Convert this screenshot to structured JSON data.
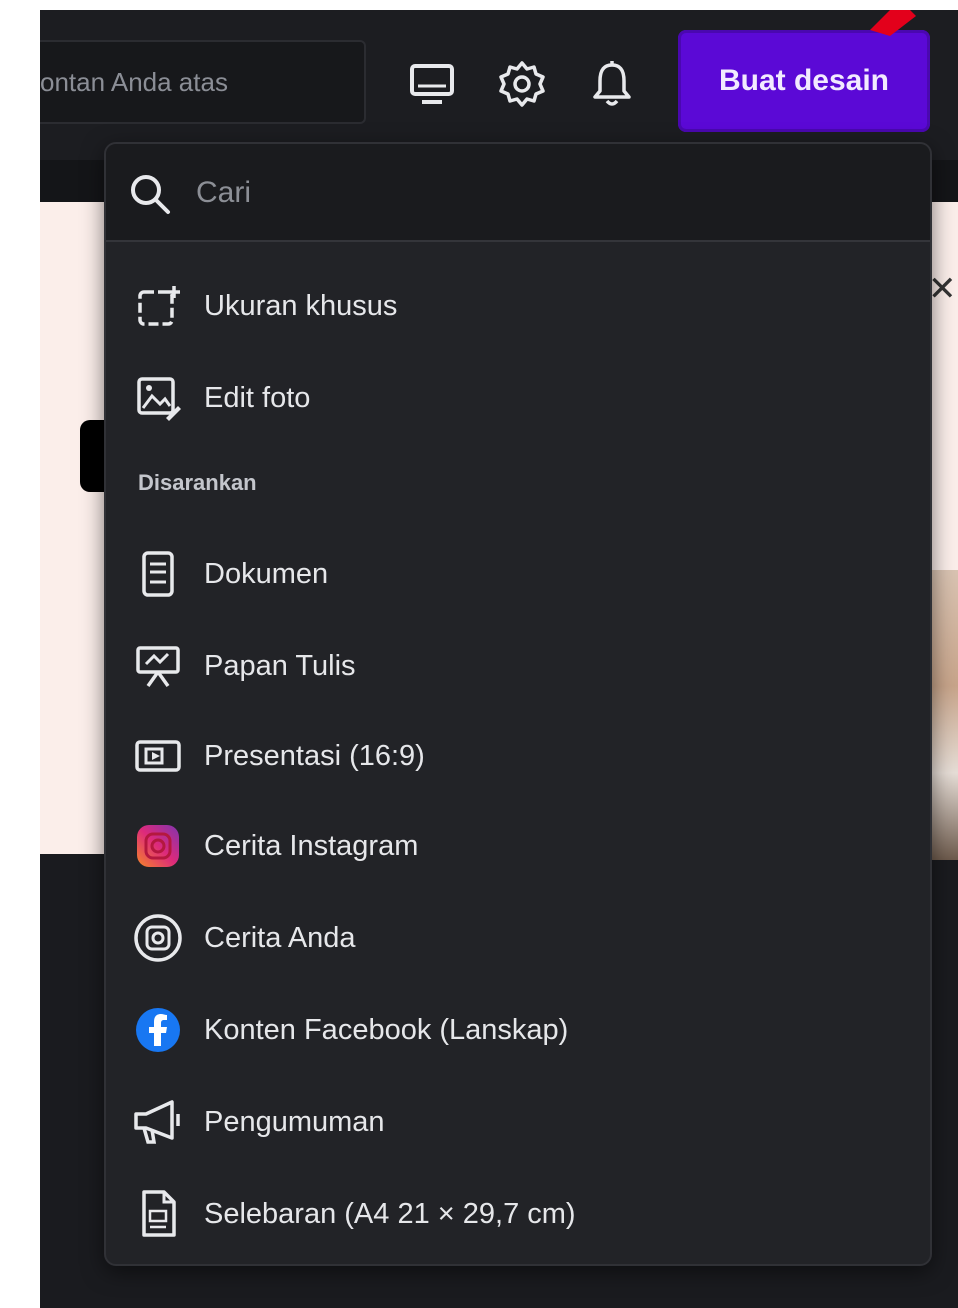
{
  "header": {
    "search_placeholder": "ontan Anda atas",
    "create_button": "Buat desain",
    "icons": [
      "monitor-icon",
      "gear-icon",
      "bell-icon"
    ]
  },
  "dropdown": {
    "search_placeholder": "Cari",
    "section_label": "Disarankan",
    "items": [
      {
        "label": "Ukuran khusus",
        "icon": "custom-size-icon"
      },
      {
        "label": "Edit foto",
        "icon": "edit-photo-icon"
      },
      {
        "label": "Dokumen",
        "icon": "document-icon"
      },
      {
        "label": "Papan Tulis",
        "icon": "whiteboard-icon"
      },
      {
        "label": "Presentasi (16:9)",
        "icon": "presentation-icon"
      },
      {
        "label": "Cerita Instagram",
        "icon": "instagram-icon"
      },
      {
        "label": "Cerita Anda",
        "icon": "your-story-icon"
      },
      {
        "label": "Konten Facebook (Lanskap)",
        "icon": "facebook-icon"
      },
      {
        "label": "Pengumuman",
        "icon": "megaphone-icon"
      },
      {
        "label": "Selebaran (A4 21 × 29,7 cm)",
        "icon": "flyer-icon"
      }
    ]
  },
  "colors": {
    "accent": "#5b09d6",
    "panel": "#222327",
    "background_pink": "#fbeeea",
    "facebook": "#1877f2",
    "instagram": "#e1306c"
  }
}
